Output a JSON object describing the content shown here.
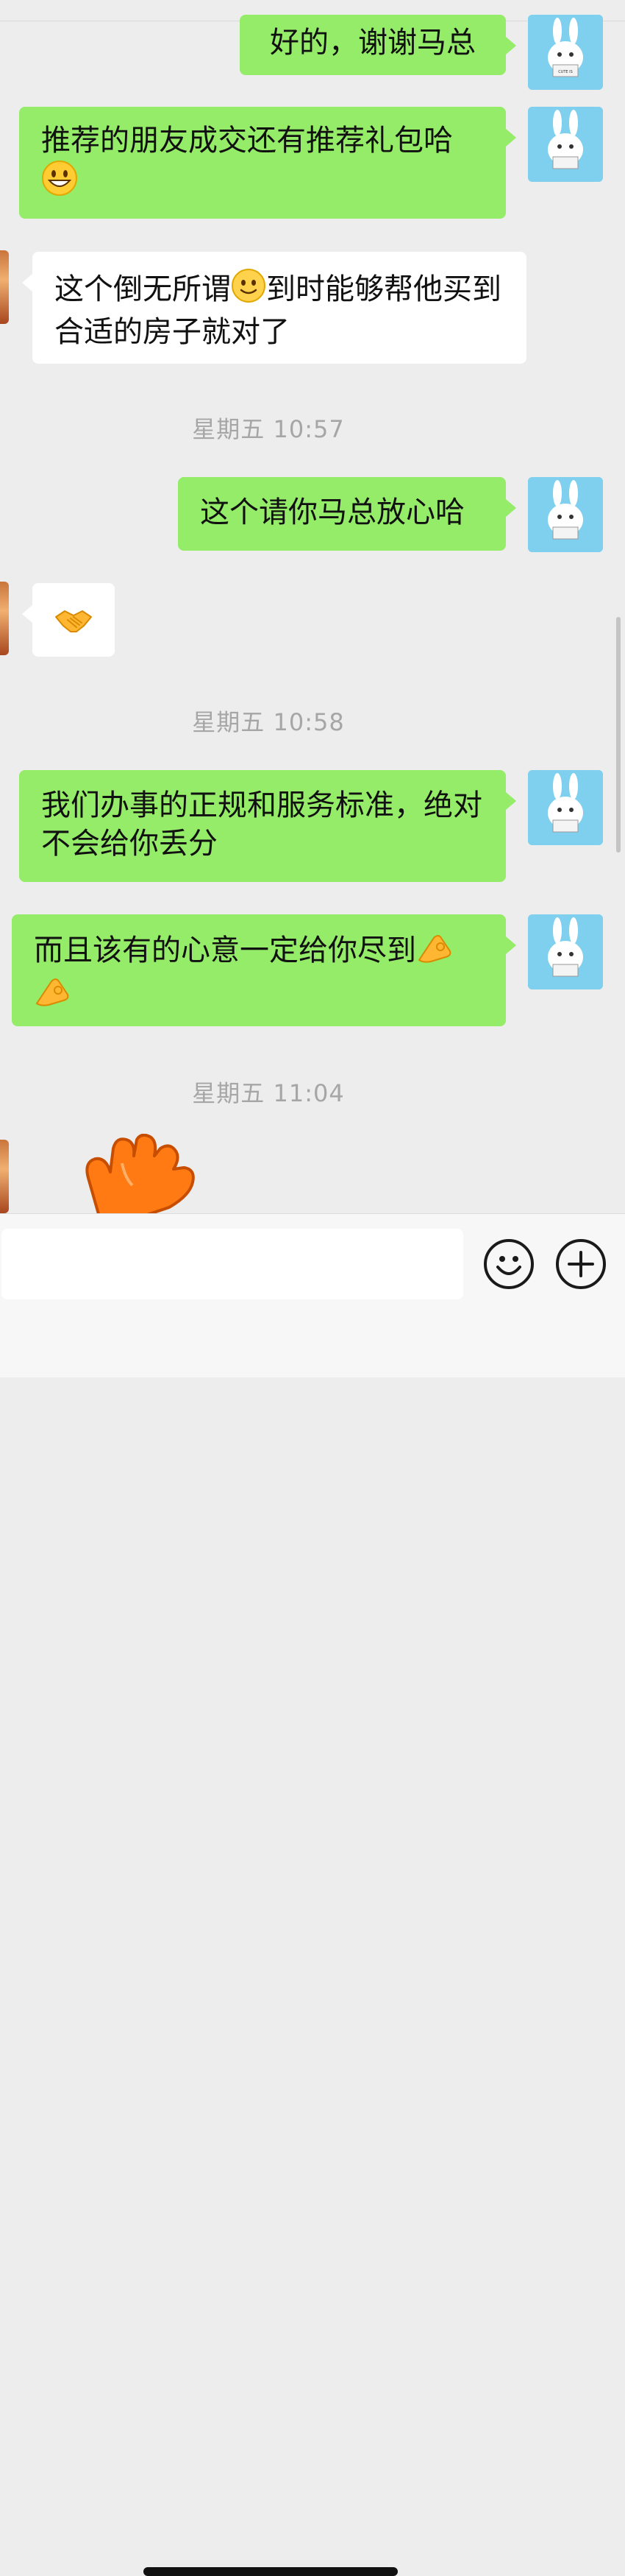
{
  "conversation": {
    "messages": [
      {
        "side": "me",
        "text": "好的，谢谢马总",
        "emoji": ""
      },
      {
        "side": "me",
        "text": "推荐的朋友成交还有推荐礼包哈",
        "emoji": "grin"
      },
      {
        "side": "other",
        "text_a": "这个倒无所谓",
        "emoji": "smile",
        "text_b": "到时能够帮他买到合适的房子就对了"
      },
      {
        "side": "me",
        "text": "这个请你马总放心哈",
        "emoji": ""
      },
      {
        "side": "other",
        "text": "",
        "emoji": "handshake"
      },
      {
        "side": "me",
        "text": "我们办事的正规和服务标准，绝对不会给你丢分",
        "emoji": ""
      },
      {
        "side": "me",
        "text": "而且该有的心意一定给你尽到",
        "emoji": "ok-hand-x2"
      }
    ],
    "timestamps": [
      "星期五 10:57",
      "星期五 10:58",
      "星期五 11:04"
    ]
  },
  "avatar": {
    "me_label": "CUTE IS JUST MY COVER",
    "me_color": "#7fd0ee"
  },
  "input_bar": {
    "placeholder": ""
  },
  "colors": {
    "bubble_me": "#95ec69",
    "bubble_other": "#ffffff",
    "background": "#ededed",
    "timestamp": "#a6a6a6"
  }
}
